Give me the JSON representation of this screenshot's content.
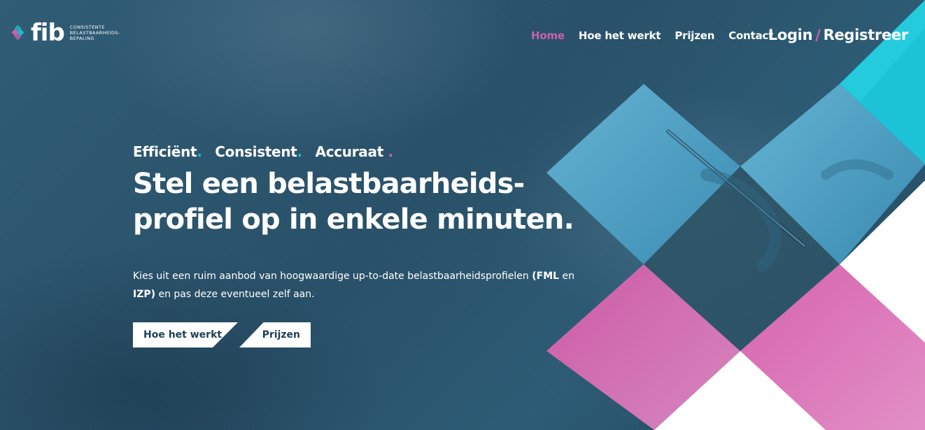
{
  "brand": {
    "logo_text": "fib",
    "tagline_lines": [
      "CONSISTENTE",
      "BELASTBAARHEIDS-",
      "BEPALING"
    ]
  },
  "nav": {
    "items": [
      {
        "label": "Home",
        "active": true
      },
      {
        "label": "Hoe het werkt",
        "active": false
      },
      {
        "label": "Prijzen",
        "active": false
      },
      {
        "label": "Contact",
        "active": false
      }
    ],
    "login": "Login",
    "separator": "/",
    "register": "Registreer"
  },
  "hero": {
    "tagline": [
      {
        "word": "Efficiënt",
        "dot": "."
      },
      {
        "word": "Consistent",
        "dot": "."
      },
      {
        "word": "Accuraat",
        "dot": "."
      }
    ],
    "headline_line1": "Stel een belastbaarheids-",
    "headline_line2": "profiel op in enkele minuten.",
    "lead_text_1": "Kies uit een ruim aanbod van hoogwaardige up-to-date belastbaarheidsprofielen",
    "lead_bold_1": "(FML",
    "lead_text_2": "en",
    "lead_bold_2": "IZP)",
    "lead_text_3": "en pas deze eventueel zelf aan.",
    "primary_button": "Hoe het werkt",
    "secondary_button": "Prijzen"
  },
  "colors": {
    "background": "#2b5670",
    "accent_cyan": "#21b8cc",
    "accent_magenta": "#c763a8",
    "diamond_blue": "#5db3d6",
    "diamond_pink": "#d46bb0",
    "button_text": "#1f3f55"
  }
}
